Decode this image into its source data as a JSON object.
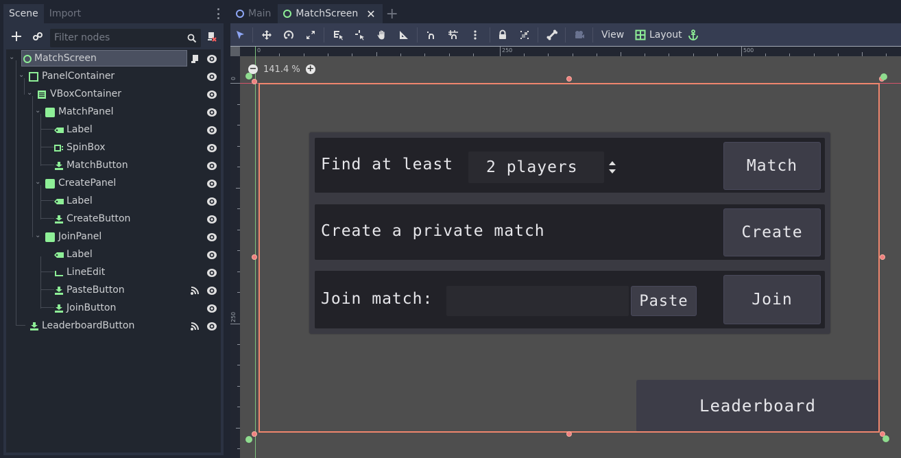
{
  "dock": {
    "tabs": [
      {
        "label": "Scene",
        "active": true
      },
      {
        "label": "Import",
        "active": false
      }
    ],
    "add_icon": "plus-icon",
    "link_icon": "link-icon",
    "filter_placeholder": "Filter nodes",
    "search_icon": "search-icon",
    "remote_icon": "script-remove-icon"
  },
  "tree": [
    {
      "name": "MatchScreen",
      "type": "Control",
      "icon": "control-ring-icon",
      "depth": 0,
      "expanded": true,
      "selected": true,
      "extra_icon": "script-icon",
      "visible": true
    },
    {
      "name": "PanelContainer",
      "type": "PanelContainer",
      "icon": "panel-container-icon",
      "depth": 1,
      "expanded": true,
      "visible": true
    },
    {
      "name": "VBoxContainer",
      "type": "VBoxContainer",
      "icon": "vbox-icon",
      "depth": 2,
      "expanded": true,
      "visible": true
    },
    {
      "name": "MatchPanel",
      "type": "Panel",
      "icon": "panel-icon",
      "depth": 3,
      "expanded": true,
      "visible": true
    },
    {
      "name": "Label",
      "type": "Label",
      "icon": "label-icon",
      "depth": 4,
      "visible": true
    },
    {
      "name": "SpinBox",
      "type": "SpinBox",
      "icon": "spinbox-icon",
      "depth": 4,
      "visible": true
    },
    {
      "name": "MatchButton",
      "type": "Button",
      "icon": "button-icon",
      "depth": 4,
      "visible": true
    },
    {
      "name": "CreatePanel",
      "type": "Panel",
      "icon": "panel-icon",
      "depth": 3,
      "expanded": true,
      "visible": true
    },
    {
      "name": "Label",
      "type": "Label",
      "icon": "label-icon",
      "depth": 4,
      "visible": true
    },
    {
      "name": "CreateButton",
      "type": "Button",
      "icon": "button-icon",
      "depth": 4,
      "visible": true
    },
    {
      "name": "JoinPanel",
      "type": "Panel",
      "icon": "panel-icon",
      "depth": 3,
      "expanded": true,
      "visible": true
    },
    {
      "name": "Label",
      "type": "Label",
      "icon": "label-icon",
      "depth": 4,
      "visible": true
    },
    {
      "name": "LineEdit",
      "type": "LineEdit",
      "icon": "lineedit-icon",
      "depth": 4,
      "visible": true
    },
    {
      "name": "PasteButton",
      "type": "Button",
      "icon": "button-icon",
      "depth": 4,
      "extra_icon": "signal-icon",
      "visible": true
    },
    {
      "name": "JoinButton",
      "type": "Button",
      "icon": "button-icon",
      "depth": 4,
      "visible": true
    },
    {
      "name": "LeaderboardButton",
      "type": "Button",
      "icon": "button-icon",
      "depth": 1,
      "extra_icon": "signal-icon",
      "visible": true
    }
  ],
  "scene_tabs": [
    {
      "label": "Main",
      "active": false,
      "ring": "blue"
    },
    {
      "label": "MatchScreen",
      "active": true,
      "ring": "green",
      "closable": true
    }
  ],
  "toolbar": {
    "tools": [
      "select-icon",
      "move-icon",
      "rotate-icon",
      "scale-icon",
      "list-select-icon",
      "pivot-icon",
      "pan-icon",
      "ruler-icon",
      "smart-snap-icon",
      "grid-snap-icon",
      "more-icon",
      "lock-icon",
      "group-icon",
      "bone-icon",
      "camera-icon"
    ],
    "view_label": "View",
    "layout_label": "Layout",
    "anchor_icon": "anchor-icon"
  },
  "viewport": {
    "zoom_label": "141.4 %",
    "ruler_h_labels": [
      "0",
      "250",
      "500"
    ],
    "ruler_v_labels": [
      "0",
      "250"
    ]
  },
  "game_ui": {
    "match_label": "Find at least",
    "spin_value": "2 players",
    "match_button": "Match",
    "create_label": "Create a private match",
    "create_button": "Create",
    "join_label": "Join match:",
    "join_input_value": "",
    "paste_button": "Paste",
    "join_button": "Join",
    "leaderboard_button": "Leaderboard"
  },
  "colors": {
    "node_icon_green": "#8eef97",
    "selection_frame": "#f0866e",
    "viewport_bg": "#4e4e4e"
  }
}
